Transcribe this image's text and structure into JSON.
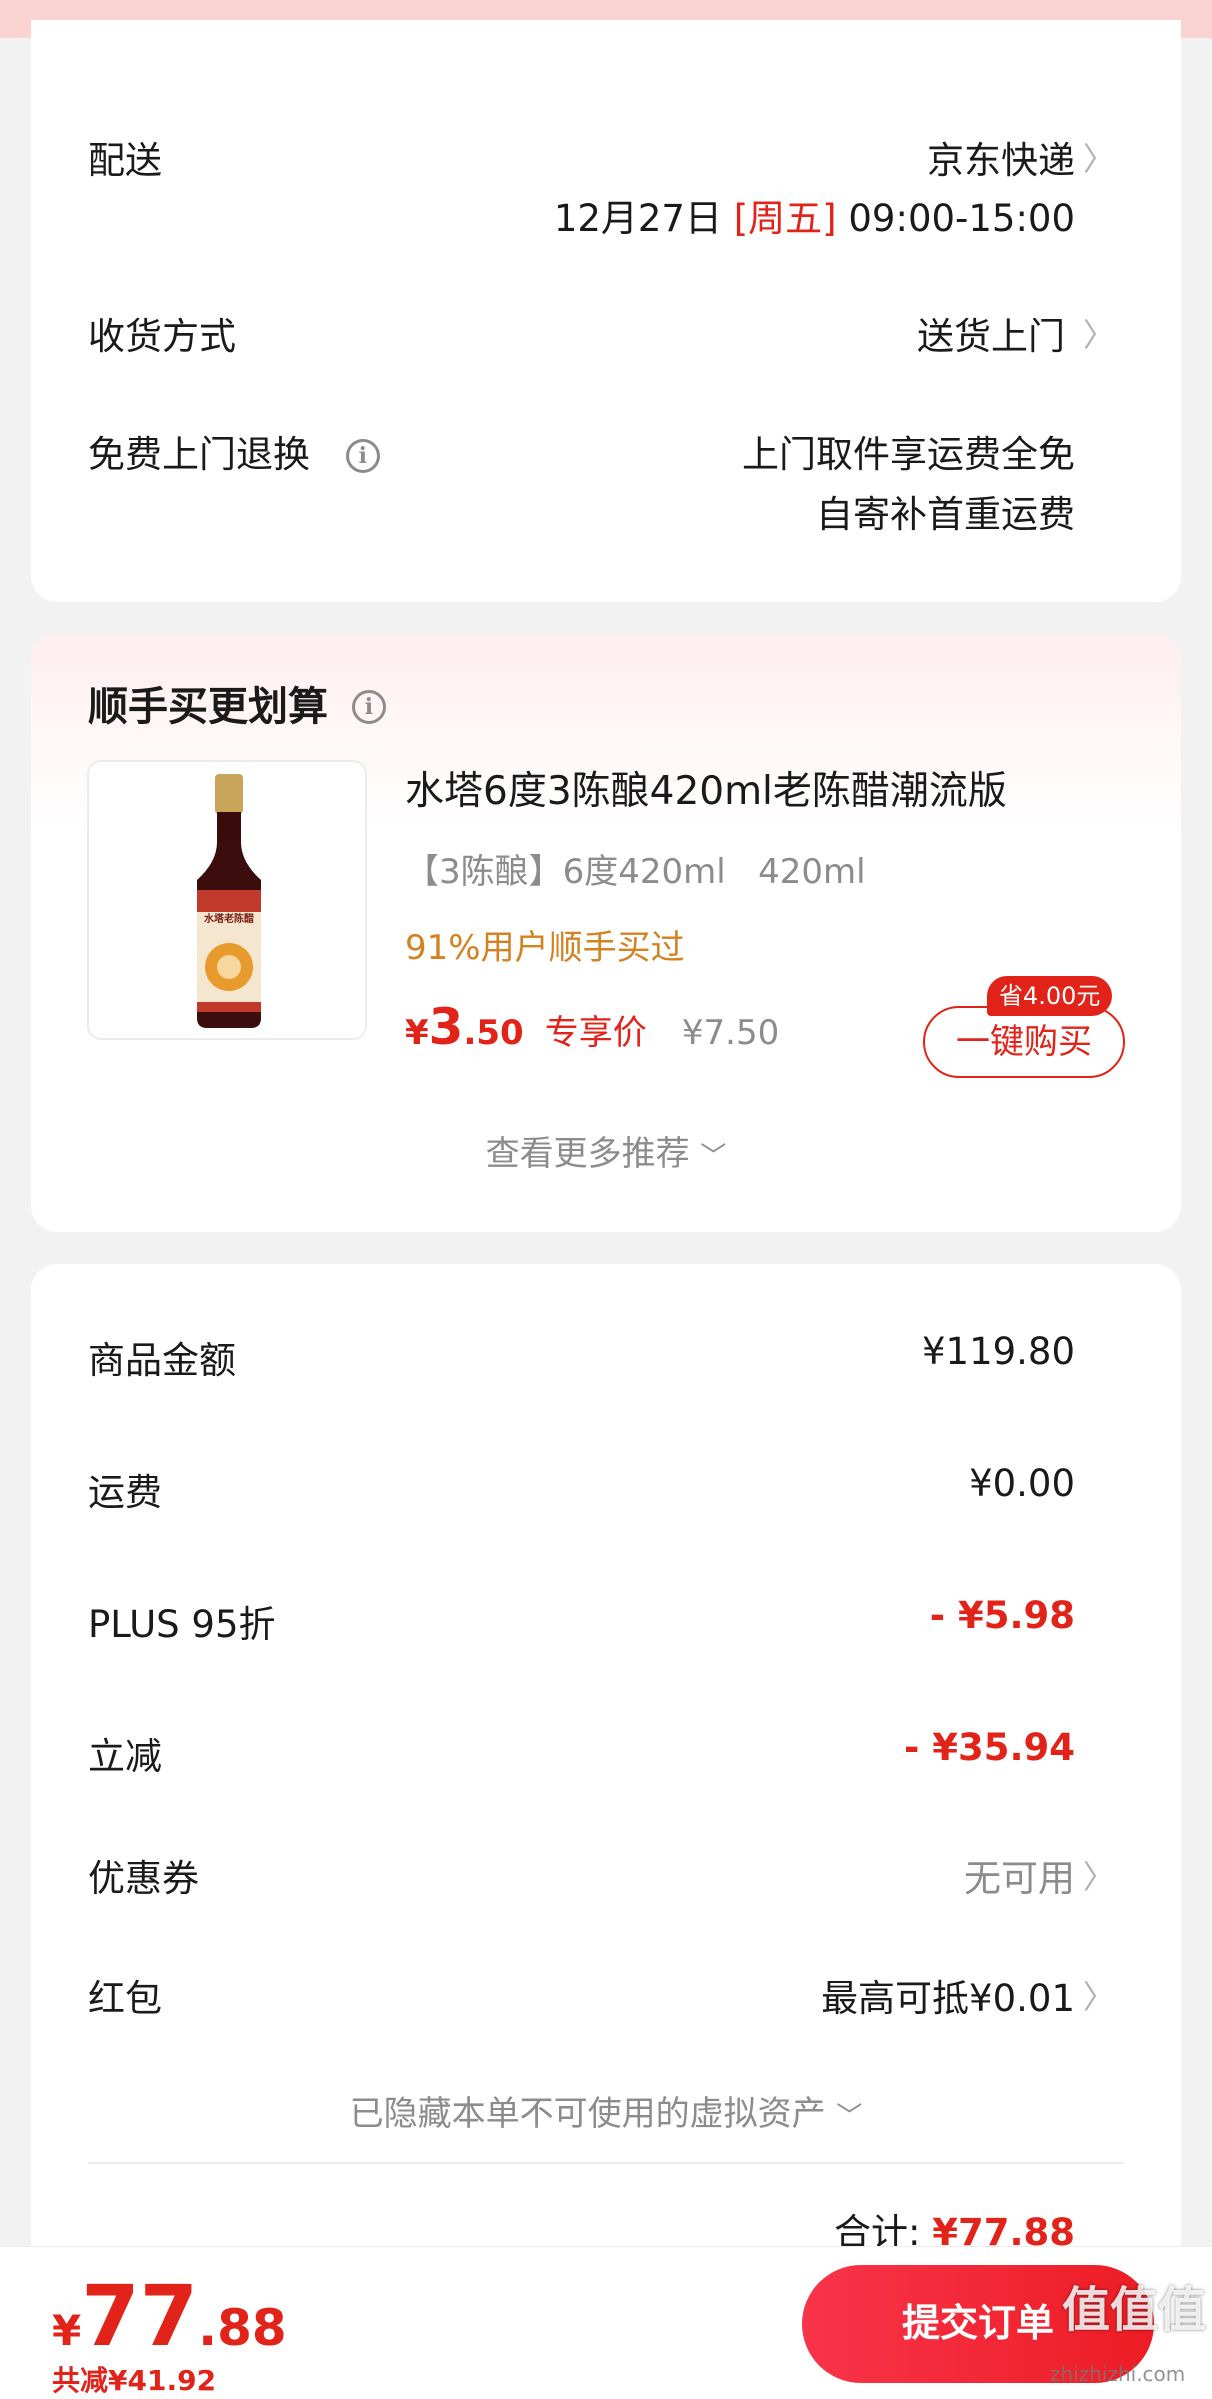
{
  "delivery": {
    "label": "配送",
    "carrier": "京东快递",
    "date": "12月27日",
    "weekday": "[周五]",
    "time": "09:00-15:00"
  },
  "receive_method": {
    "label": "收货方式",
    "value": "送货上门"
  },
  "free_return": {
    "label": "免费上门退换",
    "line1": "上门取件享运费全免",
    "line2": "自寄补首重运费"
  },
  "recommend": {
    "title": "顺手买更划算",
    "product": {
      "name": "水塔6度3陈酿420ml老陈醋潮流版",
      "spec": "【3陈酿】6度420ml   420ml",
      "bought_hint": "91%用户顺手买过",
      "price_symbol": "¥",
      "price_int": "3",
      "price_dec": ".50",
      "price_tag": "专享价",
      "original_price": "¥7.50",
      "save_badge": "省4.00元",
      "buy_button": "一键购买",
      "label_brand": "水塔老陈醋"
    },
    "more": "查看更多推荐"
  },
  "summary": {
    "goods_amount": {
      "label": "商品金额",
      "value": "¥119.80"
    },
    "shipping": {
      "label": "运费",
      "value": "¥0.00"
    },
    "plus": {
      "label": "PLUS 95折",
      "value": "- ¥5.98"
    },
    "discount": {
      "label": "立减",
      "value": "- ¥35.94"
    },
    "coupon": {
      "label": "优惠券",
      "value": "无可用"
    },
    "red_packet": {
      "label": "红包",
      "value": "最高可抵¥0.01"
    },
    "hidden_assets": "已隐藏本单不可使用的虚拟资产",
    "total_label": "合计:",
    "total_value": "¥77.88"
  },
  "bottom": {
    "symbol": "¥",
    "amount_int": "77",
    "amount_dec": ".88",
    "saved": "共减¥41.92",
    "submit": "提交订单"
  },
  "watermark": {
    "text": "值值值",
    "url": "zhizhizhi.com"
  },
  "colors": {
    "accent_red": "#e2231a",
    "hint_orange": "#d4821f",
    "chevron_gray": "#b3b3b3"
  }
}
